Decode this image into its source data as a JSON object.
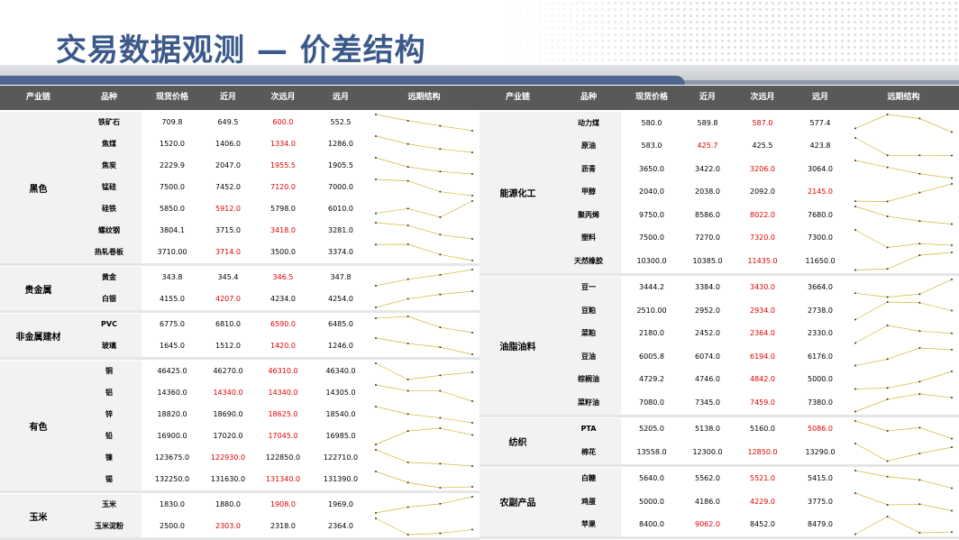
{
  "title": "交易数据观测 — 价差结构",
  "colors": {
    "header_bg": "#595959",
    "title": "#3b5a8a",
    "highlight": "#e00000",
    "spark_line": "#d4b92e",
    "spark_dot": "#333333"
  },
  "columns": [
    "产业链",
    "品种",
    "现货价格",
    "近月",
    "次远月",
    "远月",
    "远期结构"
  ],
  "left": {
    "groups": [
      {
        "category": "黑色",
        "rows": [
          {
            "name": "铁矿石",
            "spot": "709.8",
            "near": "649.5",
            "next": "600.0",
            "far": "552.5",
            "highlight": "next"
          },
          {
            "name": "焦煤",
            "spot": "1520.0",
            "near": "1406.0",
            "next": "1334.0",
            "far": "1286.0",
            "highlight": "next"
          },
          {
            "name": "焦炭",
            "spot": "2229.9",
            "near": "2047.0",
            "next": "1955.5",
            "far": "1905.5",
            "highlight": "next"
          },
          {
            "name": "锰硅",
            "spot": "7500.0",
            "near": "7452.0",
            "next": "7120.0",
            "far": "7000.0",
            "highlight": "next"
          },
          {
            "name": "硅铁",
            "spot": "5850.0",
            "near": "5912.0",
            "next": "5798.0",
            "far": "6010.0",
            "highlight": "near"
          },
          {
            "name": "螺纹钢",
            "spot": "3804.1",
            "near": "3715.0",
            "next": "3418.0",
            "far": "3281.0",
            "highlight": "next"
          },
          {
            "name": "热轧卷板",
            "spot": "3710.00",
            "near": "3714.0",
            "next": "3500.0",
            "far": "3374.0",
            "highlight": "near"
          }
        ]
      },
      {
        "category": "贵金属",
        "rows": [
          {
            "name": "黄金",
            "spot": "343.8",
            "near": "345.4",
            "next": "346.5",
            "far": "347.8",
            "highlight": "next"
          },
          {
            "name": "白银",
            "spot": "4155.0",
            "near": "4207.0",
            "next": "4234.0",
            "far": "4254.0",
            "highlight": "near"
          }
        ]
      },
      {
        "category": "非金属建材",
        "rows": [
          {
            "name": "PVC",
            "spot": "6775.0",
            "near": "6810.0",
            "next": "6590.0",
            "far": "6485.0",
            "highlight": "next"
          },
          {
            "name": "玻璃",
            "spot": "1645.0",
            "near": "1512.0",
            "next": "1420.0",
            "far": "1246.0",
            "highlight": "next"
          }
        ]
      },
      {
        "category": "有色",
        "rows": [
          {
            "name": "铜",
            "spot": "46425.0",
            "near": "46270.0",
            "next": "46310.0",
            "far": "46340.0",
            "highlight": "next"
          },
          {
            "name": "铝",
            "spot": "14360.0",
            "near": "14340.0",
            "next": "14340.0",
            "far": "14305.0",
            "highlight": "both"
          },
          {
            "name": "锌",
            "spot": "18820.0",
            "near": "18690.0",
            "next": "18625.0",
            "far": "18540.0",
            "highlight": "next"
          },
          {
            "name": "铅",
            "spot": "16900.0",
            "near": "17020.0",
            "next": "17045.0",
            "far": "16985.0",
            "highlight": "next"
          },
          {
            "name": "镍",
            "spot": "123675.0",
            "near": "122930.0",
            "next": "122850.0",
            "far": "122710.0",
            "highlight": "near"
          },
          {
            "name": "锡",
            "spot": "132250.0",
            "near": "131630.0",
            "next": "131340.0",
            "far": "131390.0",
            "highlight": "next"
          }
        ]
      },
      {
        "category": "玉米",
        "rows": [
          {
            "name": "玉米",
            "spot": "1830.0",
            "near": "1880.0",
            "next": "1908.0",
            "far": "1969.0",
            "highlight": "next"
          },
          {
            "name": "玉米淀粉",
            "spot": "2500.0",
            "near": "2303.0",
            "next": "2318.0",
            "far": "2364.0",
            "highlight": "near"
          }
        ]
      }
    ]
  },
  "right": {
    "groups": [
      {
        "category": "能源化工",
        "rows": [
          {
            "name": "动力煤",
            "spot": "580.0",
            "near": "589.8",
            "next": "587.0",
            "far": "577.4",
            "highlight": "next"
          },
          {
            "name": "原油",
            "spot": "583.0",
            "near": "425.7",
            "next": "425.5",
            "far": "423.8",
            "highlight": "near"
          },
          {
            "name": "沥青",
            "spot": "3650.0",
            "near": "3422.0",
            "next": "3206.0",
            "far": "3064.0",
            "highlight": "next"
          },
          {
            "name": "甲醇",
            "spot": "2040.0",
            "near": "2038.0",
            "next": "2092.0",
            "far": "2145.0",
            "highlight": "far"
          },
          {
            "name": "聚丙烯",
            "spot": "9750.0",
            "near": "8586.0",
            "next": "8022.0",
            "far": "7680.0",
            "highlight": "next"
          },
          {
            "name": "塑料",
            "spot": "7500.0",
            "near": "7270.0",
            "next": "7320.0",
            "far": "7300.0",
            "highlight": "next"
          },
          {
            "name": "天然橡胶",
            "spot": "10300.0",
            "near": "10385.0",
            "next": "11435.0",
            "far": "11650.0",
            "highlight": "next"
          }
        ]
      },
      {
        "category": "油脂油料",
        "rows": [
          {
            "name": "豆一",
            "spot": "3444.2",
            "near": "3384.0",
            "next": "3430.0",
            "far": "3664.0",
            "highlight": "next"
          },
          {
            "name": "豆粕",
            "spot": "2510.00",
            "near": "2952.0",
            "next": "2934.0",
            "far": "2738.0",
            "highlight": "next"
          },
          {
            "name": "菜粕",
            "spot": "2180.0",
            "near": "2452.0",
            "next": "2364.0",
            "far": "2330.0",
            "highlight": "next"
          },
          {
            "name": "豆油",
            "spot": "6005.8",
            "near": "6074.0",
            "next": "6194.0",
            "far": "6176.0",
            "highlight": "next"
          },
          {
            "name": "棕榈油",
            "spot": "4729.2",
            "near": "4746.0",
            "next": "4842.0",
            "far": "5000.0",
            "highlight": "next"
          },
          {
            "name": "菜籽油",
            "spot": "7080.0",
            "near": "7345.0",
            "next": "7459.0",
            "far": "7380.0",
            "highlight": "next"
          }
        ]
      },
      {
        "category": "纺织",
        "rows": [
          {
            "name": "PTA",
            "spot": "5205.0",
            "near": "5138.0",
            "next": "5160.0",
            "far": "5086.0",
            "highlight": "far"
          },
          {
            "name": "棉花",
            "spot": "13558.0",
            "near": "12300.0",
            "next": "12850.0",
            "far": "13290.0",
            "highlight": "next"
          }
        ]
      },
      {
        "category": "农副产品",
        "rows": [
          {
            "name": "白糖",
            "spot": "5640.0",
            "near": "5562.0",
            "next": "5521.0",
            "far": "5415.0",
            "highlight": "next"
          },
          {
            "name": "鸡蛋",
            "spot": "5000.0",
            "near": "4186.0",
            "next": "4229.0",
            "far": "3775.0",
            "highlight": "next"
          },
          {
            "name": "苹果",
            "spot": "8400.0",
            "near": "9062.0",
            "next": "8452.0",
            "far": "8479.0",
            "highlight": "near"
          }
        ]
      }
    ]
  }
}
